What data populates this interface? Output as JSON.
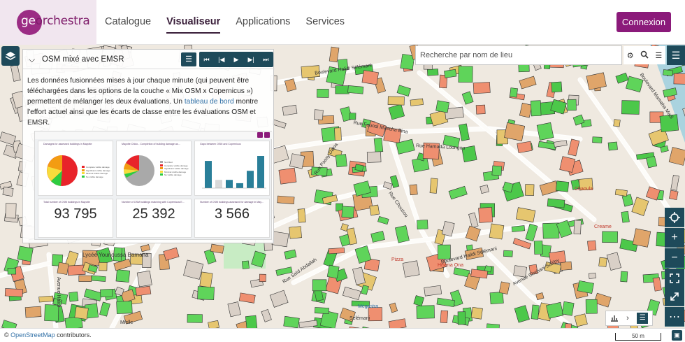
{
  "header": {
    "logo_part1": "ge",
    "logo_part2": "orchestra",
    "nav": [
      {
        "label": "Catalogue",
        "active": false
      },
      {
        "label": "Visualiseur",
        "active": true
      },
      {
        "label": "Applications",
        "active": false
      },
      {
        "label": "Services",
        "active": false
      }
    ],
    "login_label": "Connexion",
    "accent_color": "#8b1a7a"
  },
  "panel": {
    "title": "OSM mixé avec EMSR",
    "description_before": "Les données fusionnées mises à jour chaque minute (qui peuvent être téléchargées dans les options de la couche « Mix OSM x Copernicus ») permettent de mélanger les deux évaluations. Un ",
    "description_link": "tableau de bord",
    "description_after": " montre l'effort actuel ainsi que les écarts de classe entre les évaluations OSM et EMSR.",
    "media_buttons": [
      "⏮",
      "|◀",
      "▶",
      "▶|",
      "⏭"
    ]
  },
  "dashboard": {
    "cards": [
      {
        "title": "Damages for assessed buildings in Mayotte"
      },
      {
        "title": "Mayotte Chido - Completion of building damage as..."
      },
      {
        "title": "Gaps between OSM and Copernicus"
      }
    ],
    "legend1": [
      "Complete visible damage",
      "Significant visible damage",
      "Minimal visible damage",
      "No visible damage"
    ],
    "legend2": [
      "Not filled",
      "Complete visible damage",
      "Significant visible damage",
      "Minimal visible damage",
      "No visible damage"
    ],
    "bar_values": [
      3.3,
      1.0,
      1.0,
      0.6,
      2.1,
      3.9
    ],
    "stats": [
      {
        "title": "Total number of OSM buildings in Mayotte",
        "value": "93 795"
      },
      {
        "title": "Number of OSM buildings matching with Copernicus E...",
        "value": "25 392"
      },
      {
        "title": "Number of OSM buildings assessed for damage in May...",
        "value": "3 566"
      }
    ]
  },
  "search": {
    "placeholder": "Recherche par nom de lieu"
  },
  "map": {
    "labels": [
      {
        "text": "Boulevard Halidi Sélémani"
      },
      {
        "text": "Rue Foundi Maecha Bina"
      },
      {
        "text": "Rue Hamada Loungou"
      },
      {
        "text": "Rue Passy Dakia"
      },
      {
        "text": "Boulevard Halidi Sélémani"
      },
      {
        "text": "Rue Saïd Abdallah"
      },
      {
        "text": "Rue Chouzou"
      },
      {
        "text": "Avenue Chebani Soilihy"
      },
      {
        "text": "Boulevard Mamaha Madi"
      },
      {
        "text": "Chaoula"
      },
      {
        "text": "Creame"
      },
      {
        "text": "Hisena Ona"
      },
      {
        "text": "Pizza"
      },
      {
        "text": "Lycée Younoussa Bamana"
      },
      {
        "text": "Avenue Halidi"
      },
      {
        "text": "Mégastra"
      },
      {
        "text": "Lycée Younoussa Bamana"
      },
      {
        "text": "Mielle"
      },
      {
        "text": "Sélémani"
      }
    ]
  },
  "footer": {
    "attrib_prefix": "© ",
    "attrib_link": "OpenStreetMap",
    "attrib_suffix": " contributors.",
    "scale": "50 m"
  }
}
